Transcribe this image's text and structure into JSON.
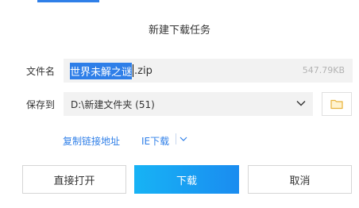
{
  "dialog": {
    "title": "新建下载任务",
    "accent_color": "#2f7fe8"
  },
  "filename_row": {
    "label": "文件名",
    "name_selected": "世界未解之谜",
    "extension": ".zip",
    "size": "547.79KB"
  },
  "save_row": {
    "label": "保存到",
    "path": "D:\\新建文件夹 (51)",
    "dropdown_icon": "chevron-down-icon",
    "folder_icon": "folder-icon"
  },
  "links": {
    "copy_link": "复制链接地址",
    "ie_download": "IE下载"
  },
  "buttons": {
    "open_direct": "直接打开",
    "download": "下载",
    "cancel": "取消"
  }
}
